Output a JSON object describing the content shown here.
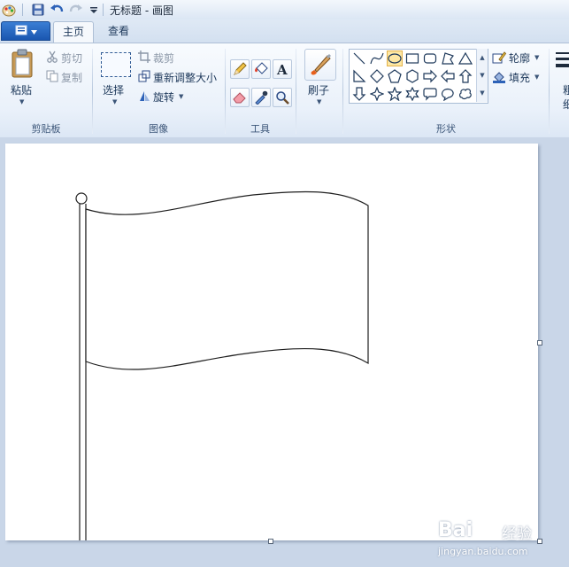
{
  "window": {
    "title": "无标题 - 画图"
  },
  "tabs": [
    {
      "label": "主页",
      "active": true
    },
    {
      "label": "查看",
      "active": false
    }
  ],
  "clipboard": {
    "paste": "粘贴",
    "cut": "剪切",
    "copy": "复制",
    "group": "剪贴板"
  },
  "image": {
    "select": "选择",
    "crop": "裁剪",
    "resize": "重新调整大小",
    "rotate": "旋转",
    "group": "图像"
  },
  "tools": {
    "group": "工具",
    "items": [
      "pencil-icon",
      "fill-bucket-icon",
      "text-icon",
      "eraser-icon",
      "color-picker-icon",
      "magnifier-icon"
    ]
  },
  "brushes": {
    "label": "刷子"
  },
  "shapes": {
    "group": "形状",
    "outline": "轮廓",
    "fill": "填充",
    "selected": "oval",
    "items": [
      "line",
      "curve",
      "oval",
      "rectangle",
      "rounded-rectangle",
      "polygon",
      "triangle",
      "right-triangle",
      "diamond",
      "pentagon",
      "hexagon",
      "right-arrow",
      "left-arrow",
      "up-arrow",
      "down-arrow",
      "four-point-star",
      "five-point-star",
      "six-point-star",
      "rounded-callout",
      "oval-callout",
      "cloud-callout"
    ]
  },
  "size": {
    "partial_label_1": "粗",
    "partial_label_2": "细"
  },
  "watermark": {
    "brand": "Bai",
    "brand2": "经验",
    "url": "jingyan.baidu.com"
  },
  "colors": {
    "accent": "#1a56b0",
    "ribbon": "#eaf1fa",
    "workspace": "#c9d6e8",
    "selected_shape": "#fde7a3"
  }
}
